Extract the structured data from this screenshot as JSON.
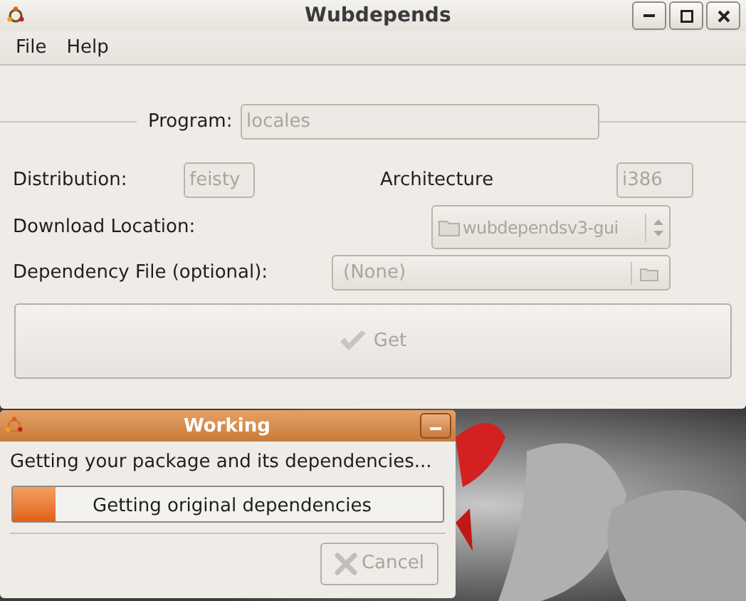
{
  "window": {
    "title": "Wubdepends"
  },
  "menu": [
    {
      "label": "File"
    },
    {
      "label": "Help"
    }
  ],
  "program": {
    "label": "Program:",
    "value": "locales",
    "disabled": true
  },
  "distribution": {
    "label": "Distribution:",
    "value": "feisty",
    "disabled": true
  },
  "architecture": {
    "label": "Architecture",
    "value": "i386",
    "disabled": true
  },
  "download_location": {
    "label": "Download Location:",
    "value": "wubdependsv3-gui",
    "disabled": true
  },
  "dependency_file": {
    "label": "Dependency File (optional):",
    "value": "(None)",
    "disabled": true
  },
  "get_button": {
    "label": "Get",
    "disabled": true
  },
  "dialog": {
    "title": "Working",
    "message": "Getting your package and its dependencies...",
    "progress": {
      "level": 0.1,
      "text": "Getting original dependencies"
    },
    "cancel_button": {
      "label": "Cancel",
      "disabled": true
    }
  }
}
